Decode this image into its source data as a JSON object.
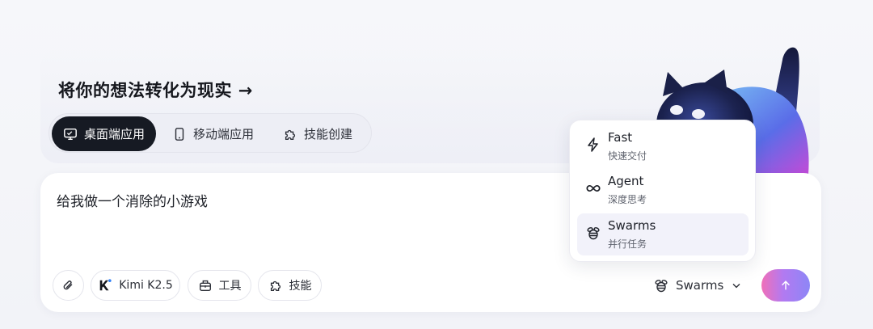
{
  "headline": "将你的想法转化为现实 →",
  "mode_tabs": [
    {
      "label": "桌面端应用",
      "icon": "monitor-icon",
      "active": true
    },
    {
      "label": "移动端应用",
      "icon": "phone-icon",
      "active": false
    },
    {
      "label": "技能创建",
      "icon": "puzzle-icon",
      "active": false
    }
  ],
  "composer": {
    "prompt_text": "给我做一个消除的小游戏"
  },
  "toolbar": {
    "attach_icon": "paperclip-icon",
    "model_label": "Kimi K2.5",
    "tools_label": "工具",
    "skills_label": "技能",
    "mode_select_label": "Swarms"
  },
  "mode_menu": {
    "options": [
      {
        "title": "Fast",
        "subtitle": "快速交付",
        "icon": "lightning-icon",
        "selected": false
      },
      {
        "title": "Agent",
        "subtitle": "深度思考",
        "icon": "infinity-icon",
        "selected": false
      },
      {
        "title": "Swarms",
        "subtitle": "并行任务",
        "icon": "bee-icon",
        "selected": true
      }
    ]
  },
  "colors": {
    "active_tab_bg": "#161a23",
    "send_gradient_start": "#f06fb8",
    "send_gradient_end": "#8d86f6",
    "selected_option_bg": "#f2f2fa"
  }
}
